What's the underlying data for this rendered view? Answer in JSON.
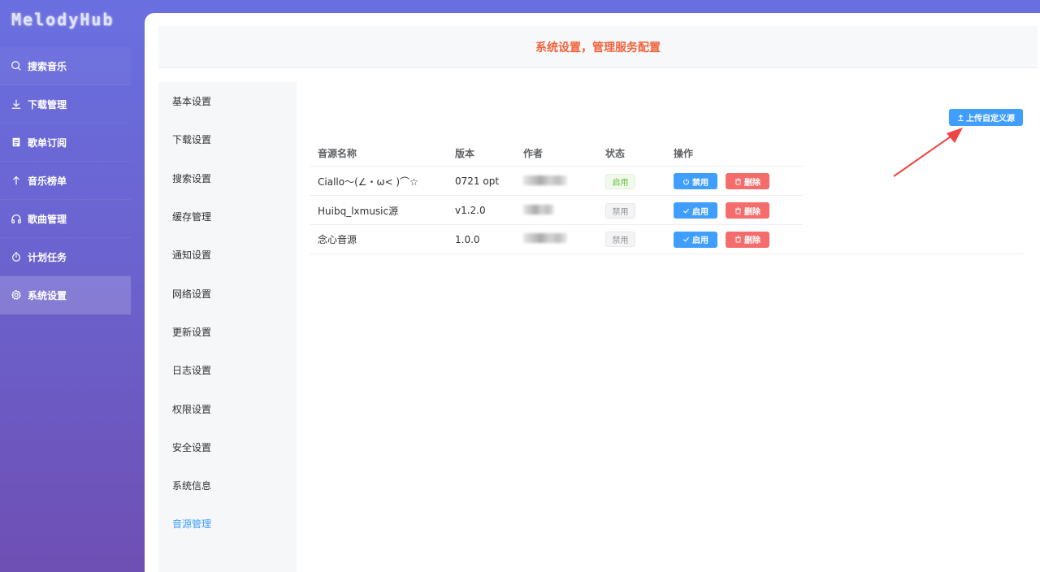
{
  "app": {
    "logo": "MelodyHub"
  },
  "sidebar": {
    "items": [
      {
        "label": "搜索音乐",
        "icon": "search-icon"
      },
      {
        "label": "下载管理",
        "icon": "download-icon"
      },
      {
        "label": "歌单订阅",
        "icon": "clipboard-icon"
      },
      {
        "label": "音乐榜单",
        "icon": "arrow-up-icon"
      },
      {
        "label": "歌曲管理",
        "icon": "headphones-icon"
      },
      {
        "label": "计划任务",
        "icon": "timer-icon"
      },
      {
        "label": "系统设置",
        "icon": "gear-icon",
        "active": true
      }
    ]
  },
  "header": {
    "title": "系统设置，管理服务配置"
  },
  "settings_menu": {
    "items": [
      "基本设置",
      "下载设置",
      "搜索设置",
      "缓存管理",
      "通知设置",
      "网络设置",
      "更新设置",
      "日志设置",
      "权限设置",
      "安全设置",
      "系统信息",
      "音源管理"
    ],
    "active": "音源管理"
  },
  "upload_button": {
    "label": "上传自定义源",
    "icon": "upload-icon"
  },
  "table": {
    "headers": [
      "音源名称",
      "版本",
      "作者",
      "状态",
      "操作"
    ],
    "rows": [
      {
        "name": "Ciallo～(∠・ω< )⌒☆",
        "version": "0721 opt",
        "status": "启用",
        "toggle_label": "禁用",
        "delete_label": "删除"
      },
      {
        "name": "Huibq_lxmusic源",
        "version": "v1.2.0",
        "status": "禁用",
        "toggle_label": "启用",
        "delete_label": "删除"
      },
      {
        "name": "念心音源",
        "version": "1.0.0",
        "status": "禁用",
        "toggle_label": "启用",
        "delete_label": "删除"
      }
    ]
  },
  "colors": {
    "accent": "#409eff",
    "danger": "#f56c6c",
    "success": "#67c23a",
    "header_title": "#f0643c",
    "annotation_arrow": "#ef4444"
  }
}
